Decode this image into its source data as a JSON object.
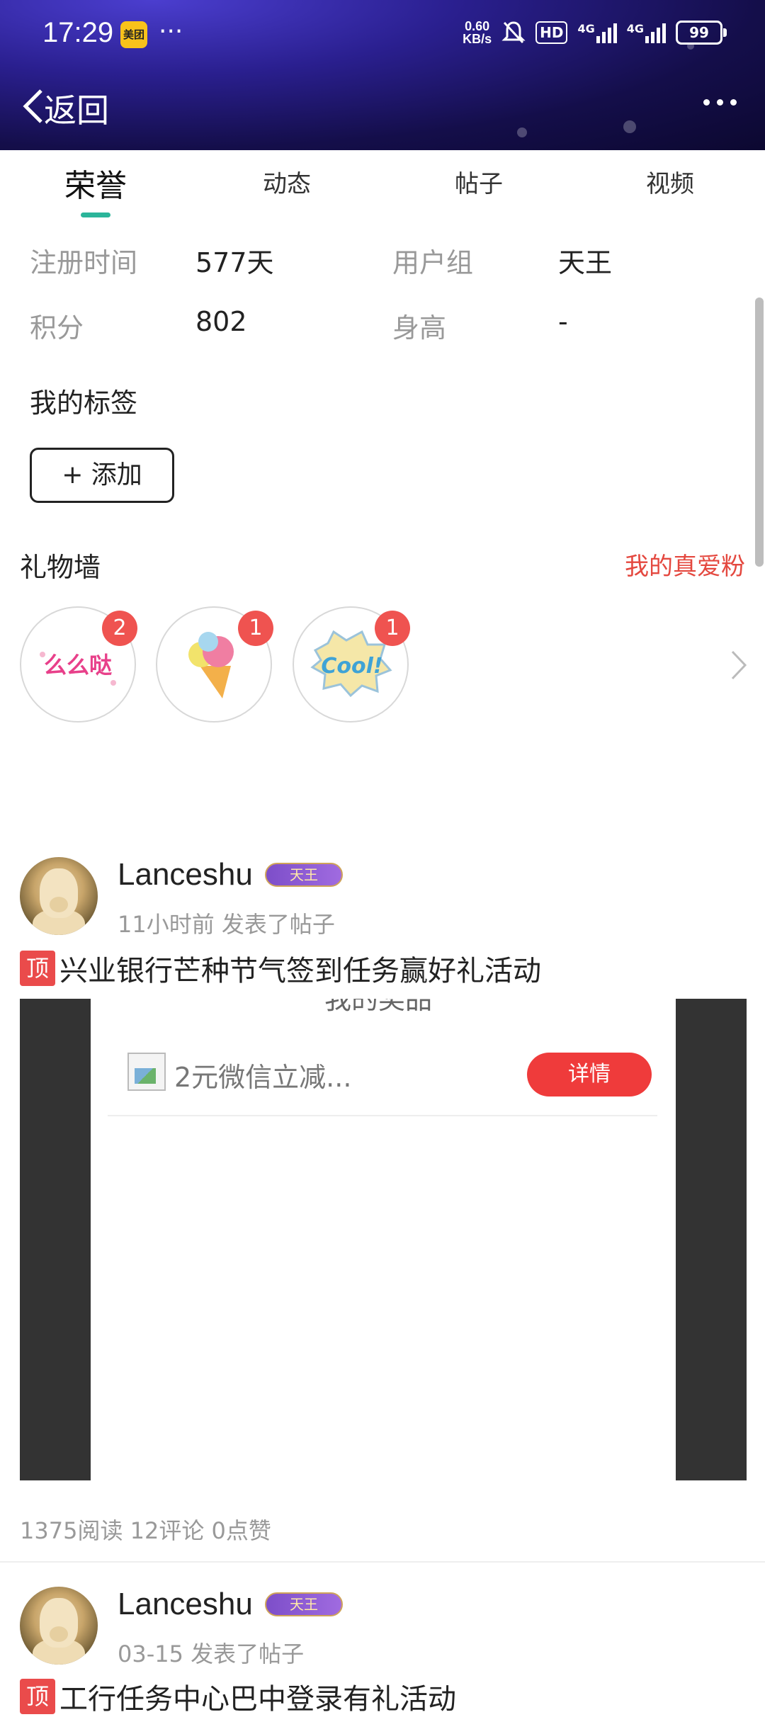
{
  "status_bar": {
    "time": "17:29",
    "app_badge": "美团",
    "overflow": "···",
    "net_speed_value": "0.60",
    "net_speed_unit": "KB/s",
    "hd": "HD",
    "net1": "4G",
    "net2": "4G",
    "battery": "99"
  },
  "nav": {
    "back_label": "返回"
  },
  "tabs": [
    {
      "label": "荣誉",
      "active": true
    },
    {
      "label": "动态",
      "active": false
    },
    {
      "label": "帖子",
      "active": false
    },
    {
      "label": "视频",
      "active": false
    }
  ],
  "profile": {
    "register_label": "注册时间",
    "register_value": "577天",
    "group_label": "用户组",
    "group_value": "天王",
    "points_label": "积分",
    "points_value": "802",
    "height_label": "身高",
    "height_value": "-",
    "tags_title": "我的标签",
    "add_button": "+ 添加"
  },
  "gift_wall": {
    "title": "礼物墙",
    "fans_link": "我的真爱粉",
    "gifts": [
      {
        "name": "么么哒",
        "count": "2"
      },
      {
        "name": "ice-cream",
        "count": "1"
      },
      {
        "name": "Cool!",
        "count": "1"
      }
    ]
  },
  "posts": [
    {
      "username": "Lanceshu",
      "rank": "天王",
      "time": "11小时前",
      "action": "发表了帖子",
      "top_tag": "顶",
      "title": "兴业银行芒种节气签到任务赢好礼活动",
      "image": {
        "cut_text": "我的奖品",
        "coupon": "2元微信立减...",
        "button": "详情"
      },
      "stats": "1375阅读  12评论  0点赞"
    },
    {
      "username": "Lanceshu",
      "rank": "天王",
      "time": "03-15",
      "action": "发表了帖子",
      "top_tag": "顶",
      "title": "工行任务中心巴中登录有礼活动"
    }
  ],
  "colors": {
    "accent_tab": "#2bb59a",
    "link_red": "#e4483f",
    "badge_red": "#ef5350"
  }
}
